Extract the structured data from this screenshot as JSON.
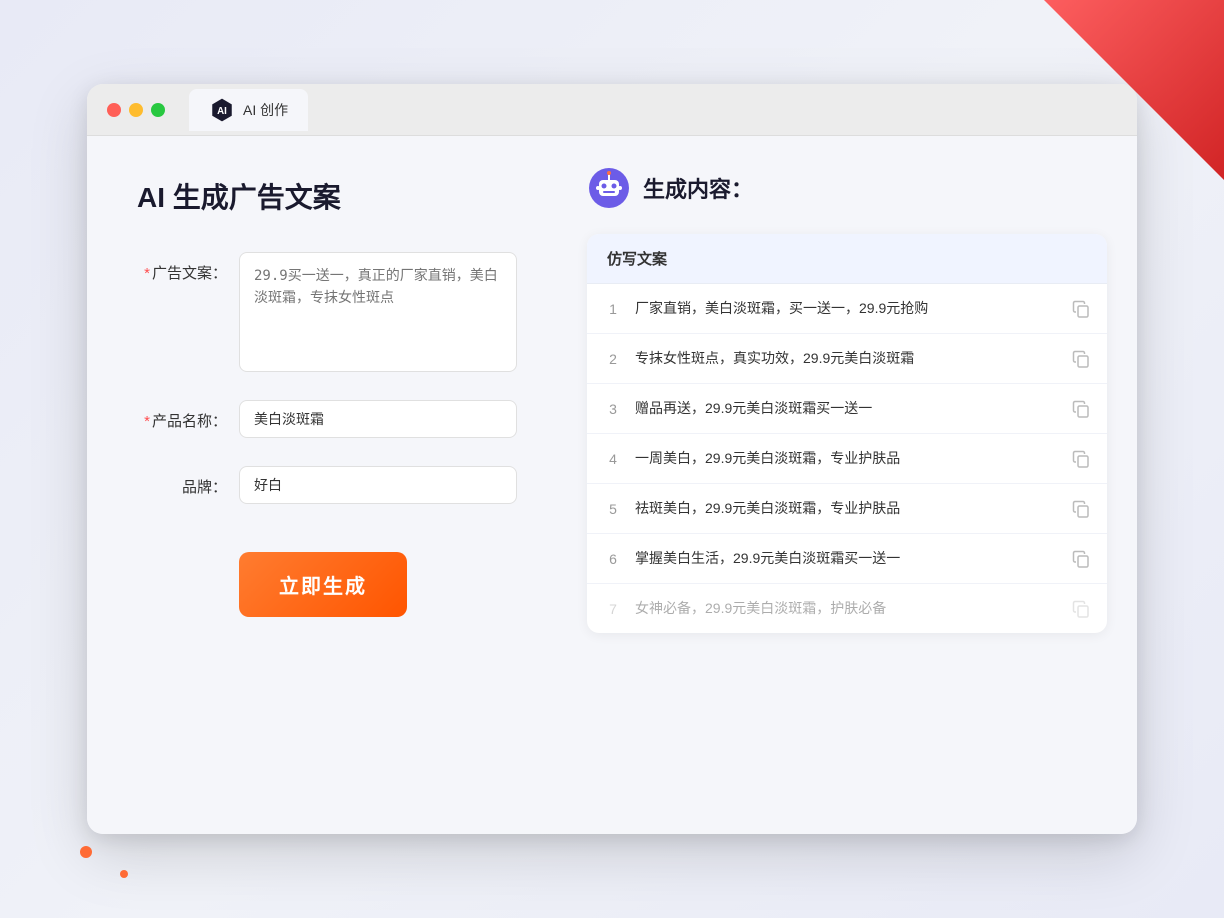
{
  "window": {
    "tab_label": "AI 创作"
  },
  "page": {
    "title": "AI 生成广告文案",
    "result_title": "生成内容："
  },
  "form": {
    "ad_copy_label": "广告文案：",
    "ad_copy_placeholder": "29.9买一送一，真正的厂家直销，美白淡斑霜，专抹女性斑点",
    "product_name_label": "产品名称：",
    "product_name_value": "美白淡斑霜",
    "brand_label": "品牌：",
    "brand_value": "好白",
    "required_mark": "*",
    "generate_button": "立即生成"
  },
  "results": {
    "table_header": "仿写文案",
    "items": [
      {
        "num": "1",
        "text": "厂家直销，美白淡斑霜，买一送一，29.9元抢购",
        "dimmed": false
      },
      {
        "num": "2",
        "text": "专抹女性斑点，真实功效，29.9元美白淡斑霜",
        "dimmed": false
      },
      {
        "num": "3",
        "text": "赠品再送，29.9元美白淡斑霜买一送一",
        "dimmed": false
      },
      {
        "num": "4",
        "text": "一周美白，29.9元美白淡斑霜，专业护肤品",
        "dimmed": false
      },
      {
        "num": "5",
        "text": "祛斑美白，29.9元美白淡斑霜，专业护肤品",
        "dimmed": false
      },
      {
        "num": "6",
        "text": "掌握美白生活，29.9元美白淡斑霜买一送一",
        "dimmed": false
      },
      {
        "num": "7",
        "text": "女神必备，29.9元美白淡斑霜，护肤必备",
        "dimmed": true
      }
    ]
  },
  "colors": {
    "accent_orange": "#ff6820",
    "required_red": "#ff4d4f",
    "primary_text": "#1a1a2e",
    "secondary_text": "#666",
    "border": "#e0e0e0"
  }
}
